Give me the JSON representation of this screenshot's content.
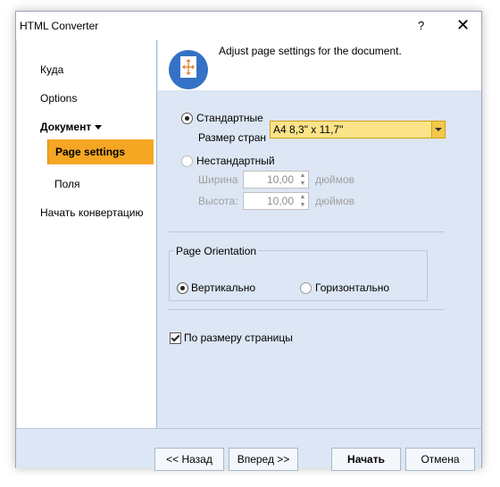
{
  "window": {
    "title": "HTML Converter",
    "help_label": "?",
    "close_label": "✕"
  },
  "nav": {
    "items": [
      "Куда",
      "Options",
      "Документ",
      "Page settings",
      "Поля",
      "Начать конвертацию"
    ]
  },
  "header": {
    "text": "Adjust page settings for the document.",
    "icon": "page-size-icon"
  },
  "settings": {
    "standard_label": "Стандартные",
    "size_label": "Размер стран",
    "size_value": "A4 8,3\" x 11,7\"",
    "custom_label": "Нестандартный",
    "width_label": "Ширина",
    "width_value": "10,00",
    "width_unit": "дюймов",
    "height_label": "Высота:",
    "height_value": "10,00",
    "height_unit": "дюймов"
  },
  "orientation": {
    "title": "Page Orientation",
    "portrait_label": "Вертикально",
    "landscape_label": "Горизонтально"
  },
  "fit": {
    "label": "По размеру страницы"
  },
  "buttons": {
    "back": "<< Назад",
    "next": "Вперед >>",
    "start": "Начать",
    "cancel": "Отмена"
  },
  "colors": {
    "accent": "#f5a623",
    "panel": "#dce6f4",
    "icon": "#3572c6"
  }
}
